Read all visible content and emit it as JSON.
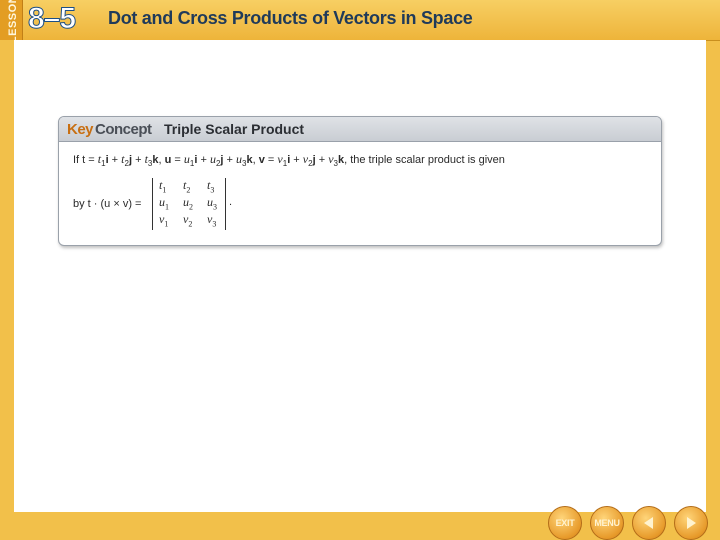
{
  "header": {
    "lesson_tab": "LESSON",
    "lesson_number": "8–5",
    "title": "Dot and Cross Products of Vectors in Space"
  },
  "key_concept": {
    "label_key": "Key",
    "label_concept": "Concept",
    "title": "Triple Scalar Product",
    "definition_tail": ", the triple scalar product is given",
    "by_prefix": "by t · (u × v) =",
    "period": "."
  },
  "nav": {
    "exit_label": "EXIT",
    "menu_label": "MENU"
  },
  "colors": {
    "banner": "#f2c04a",
    "key_orange": "#c86f12",
    "button_orange": "#e79a2a"
  }
}
